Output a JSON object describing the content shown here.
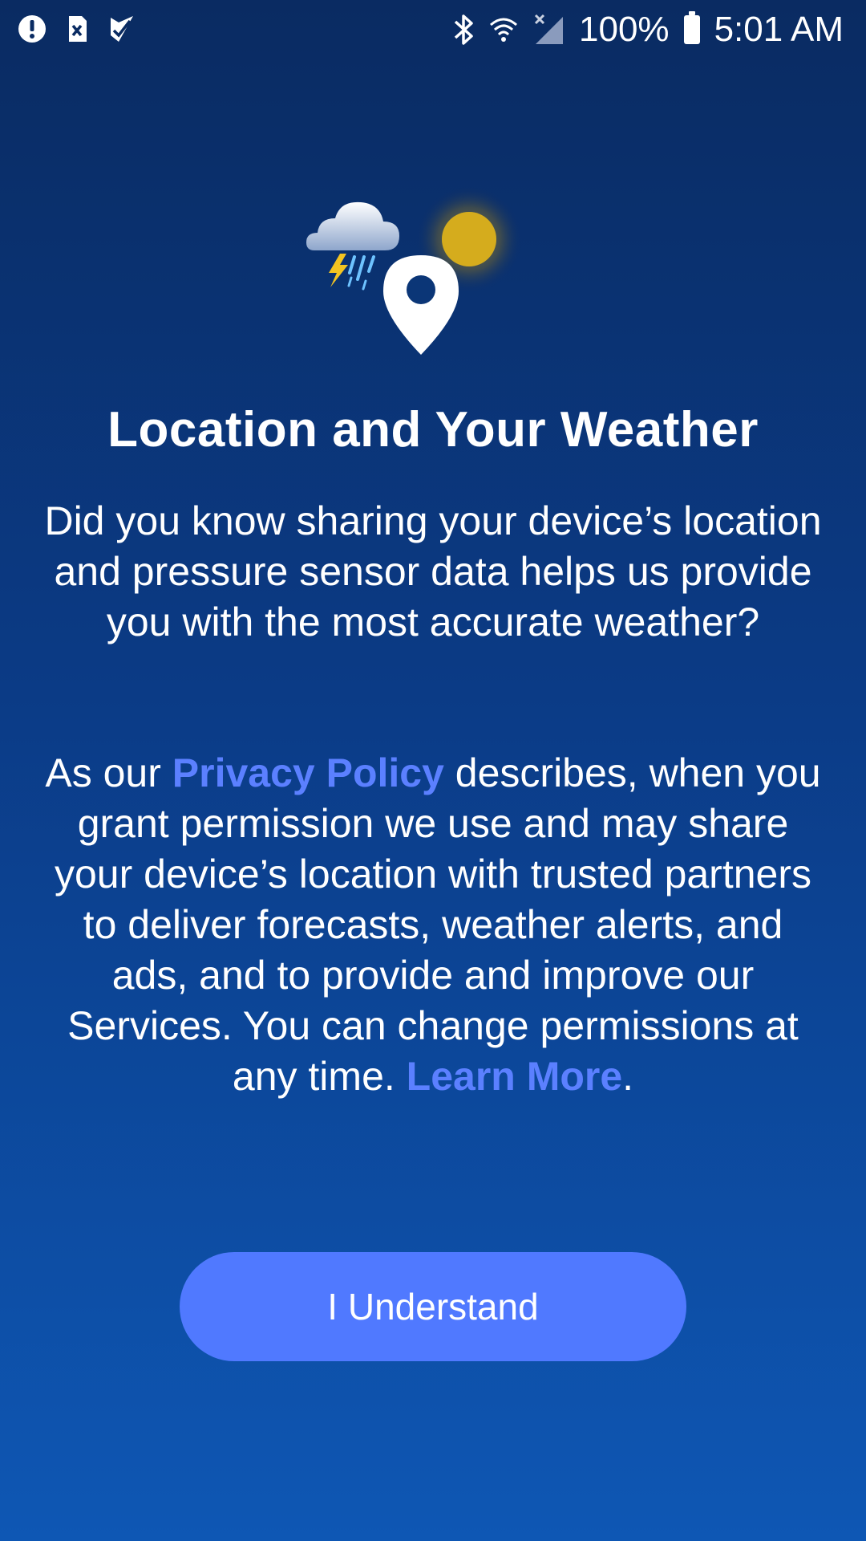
{
  "status_bar": {
    "left_icons": [
      "alert-circle-icon",
      "sim-error-icon",
      "tasks-check-icon"
    ],
    "right_icons": [
      "bluetooth-icon",
      "wifi-icon",
      "cell-signal-off-icon",
      "battery-icon"
    ],
    "battery": "100%",
    "time": "5:01 AM"
  },
  "hero": {
    "icons": [
      "thunderstorm-cloud-icon",
      "sun-icon",
      "location-pin-icon"
    ]
  },
  "title": "Location and Your Weather",
  "paragraph1": "Did you know sharing your device’s location and pressure sensor data helps us provide you with the most accurate weather?",
  "paragraph2": {
    "prefix": "As our ",
    "privacy_link": "Privacy Policy",
    "body": " describes, when you grant permission we use and may share your device’s location with trusted partners to deliver forecasts, weather alerts, and ads, and to provide and improve our Services. You can change permissions at any time. ",
    "learn_more_link": "Learn More",
    "suffix": "."
  },
  "button": {
    "label": "I Understand"
  },
  "colors": {
    "background_top": "#0a2b62",
    "background_bottom": "#0e57b4",
    "link": "#5b80ff",
    "button": "#5079ff"
  }
}
